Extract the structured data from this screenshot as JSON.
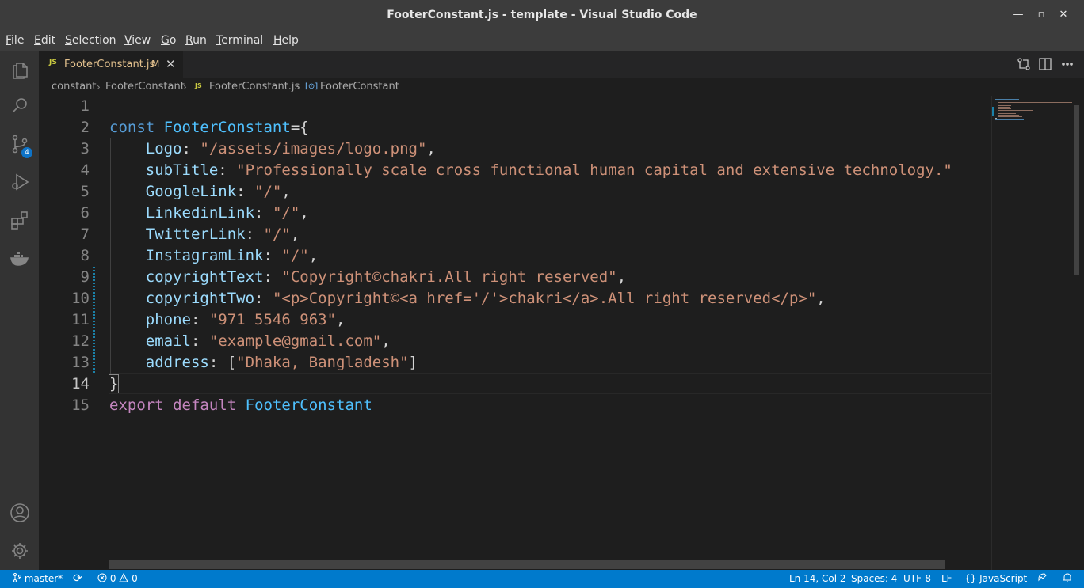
{
  "window": {
    "title": "FooterConstant.js - template - Visual Studio Code",
    "minimize_glyph": "—",
    "maximize_glyph": "▫",
    "close_glyph": "✕"
  },
  "menu": [
    {
      "underline": "F",
      "rest": "ile"
    },
    {
      "underline": "E",
      "rest": "dit"
    },
    {
      "underline": "S",
      "rest": "election"
    },
    {
      "underline": "V",
      "rest": "iew"
    },
    {
      "underline": "G",
      "rest": "o"
    },
    {
      "underline": "R",
      "rest": "un"
    },
    {
      "underline": "T",
      "rest": "erminal"
    },
    {
      "underline": "H",
      "rest": "elp"
    }
  ],
  "activity_bar": {
    "icons": [
      "files-icon",
      "search-icon",
      "source-control-icon",
      "run-debug-icon",
      "extensions-icon",
      "docker-icon",
      "account-icon",
      "manage-gear-icon"
    ],
    "source_control_badge": "4"
  },
  "tab": {
    "file_icon": "JS",
    "name": "FooterConstant.js",
    "modified": "M",
    "close_glyph": "✕"
  },
  "breadcrumb": {
    "folder": "constant",
    "subfolder": "FooterConstant",
    "file_icon": "JS",
    "file": "FooterConstant.js",
    "symbol_icon": "[⊙]",
    "symbol": "FooterConstant"
  },
  "editor": {
    "active_line": 14,
    "lines": [
      {
        "n": "1",
        "tokens": []
      },
      {
        "n": "2",
        "tokens": [
          [
            "kw",
            "const"
          ],
          [
            "pun",
            " "
          ],
          [
            "var",
            "FooterConstant"
          ],
          [
            "pun",
            "={"
          ]
        ]
      },
      {
        "n": "3",
        "tokens": [
          [
            "pun",
            "    "
          ],
          [
            "prop",
            "Logo"
          ],
          [
            "pun",
            ": "
          ],
          [
            "str",
            "\"/assets/images/logo.png\""
          ],
          [
            "pun",
            ","
          ]
        ]
      },
      {
        "n": "4",
        "tokens": [
          [
            "pun",
            "    "
          ],
          [
            "prop",
            "subTitle"
          ],
          [
            "pun",
            ": "
          ],
          [
            "str",
            "\"Professionally scale cross functional human capital and extensive technology.\""
          ]
        ]
      },
      {
        "n": "5",
        "tokens": [
          [
            "pun",
            "    "
          ],
          [
            "prop",
            "GoogleLink"
          ],
          [
            "pun",
            ": "
          ],
          [
            "str",
            "\"/\""
          ],
          [
            "pun",
            ","
          ]
        ]
      },
      {
        "n": "6",
        "tokens": [
          [
            "pun",
            "    "
          ],
          [
            "prop",
            "LinkedinLink"
          ],
          [
            "pun",
            ": "
          ],
          [
            "str",
            "\"/\""
          ],
          [
            "pun",
            ","
          ]
        ]
      },
      {
        "n": "7",
        "tokens": [
          [
            "pun",
            "    "
          ],
          [
            "prop",
            "TwitterLink"
          ],
          [
            "pun",
            ": "
          ],
          [
            "str",
            "\"/\""
          ],
          [
            "pun",
            ","
          ]
        ]
      },
      {
        "n": "8",
        "tokens": [
          [
            "pun",
            "    "
          ],
          [
            "prop",
            "InstagramLink"
          ],
          [
            "pun",
            ": "
          ],
          [
            "str",
            "\"/\""
          ],
          [
            "pun",
            ","
          ]
        ]
      },
      {
        "n": "9",
        "tokens": [
          [
            "pun",
            "    "
          ],
          [
            "prop",
            "copyrightText"
          ],
          [
            "pun",
            ": "
          ],
          [
            "str",
            "\"Copyright©chakri.All right reserved\""
          ],
          [
            "pun",
            ","
          ]
        ]
      },
      {
        "n": "10",
        "tokens": [
          [
            "pun",
            "    "
          ],
          [
            "prop",
            "copyrightTwo"
          ],
          [
            "pun",
            ": "
          ],
          [
            "str",
            "\"<p>Copyright©<a href='/'>chakri</a>.All right reserved</p>\""
          ],
          [
            "pun",
            ","
          ]
        ]
      },
      {
        "n": "11",
        "tokens": [
          [
            "pun",
            "    "
          ],
          [
            "prop",
            "phone"
          ],
          [
            "pun",
            ": "
          ],
          [
            "str",
            "\"971 5546 963\""
          ],
          [
            "pun",
            ","
          ]
        ]
      },
      {
        "n": "12",
        "tokens": [
          [
            "pun",
            "    "
          ],
          [
            "prop",
            "email"
          ],
          [
            "pun",
            ": "
          ],
          [
            "str",
            "\"example@gmail.com\""
          ],
          [
            "pun",
            ","
          ]
        ]
      },
      {
        "n": "13",
        "tokens": [
          [
            "pun",
            "    "
          ],
          [
            "prop",
            "address"
          ],
          [
            "pun",
            ": ["
          ],
          [
            "str",
            "\"Dhaka, Bangladesh\""
          ],
          [
            "pun",
            "]"
          ]
        ]
      },
      {
        "n": "14",
        "tokens": [
          [
            "brace",
            "}"
          ]
        ]
      },
      {
        "n": "15",
        "tokens": [
          [
            "ctrl",
            "export"
          ],
          [
            "pun",
            " "
          ],
          [
            "ctrl",
            "default"
          ],
          [
            "pun",
            " "
          ],
          [
            "var",
            "FooterConstant"
          ]
        ]
      }
    ]
  },
  "status_bar": {
    "branch": "master*",
    "sync_glyph": "⟳",
    "errors": "0",
    "warnings": "0",
    "cursor": "Ln 14, Col 2",
    "indent": "Spaces: 4",
    "encoding": "UTF-8",
    "eol": "LF",
    "language_icon": "{}",
    "language": "JavaScript"
  },
  "colors": {
    "keyword": "#569cd6",
    "control": "#c586c0",
    "variable": "#4fc1ff",
    "property": "#9cdcfe",
    "string": "#ce9178",
    "status_bar": "#007acc"
  }
}
